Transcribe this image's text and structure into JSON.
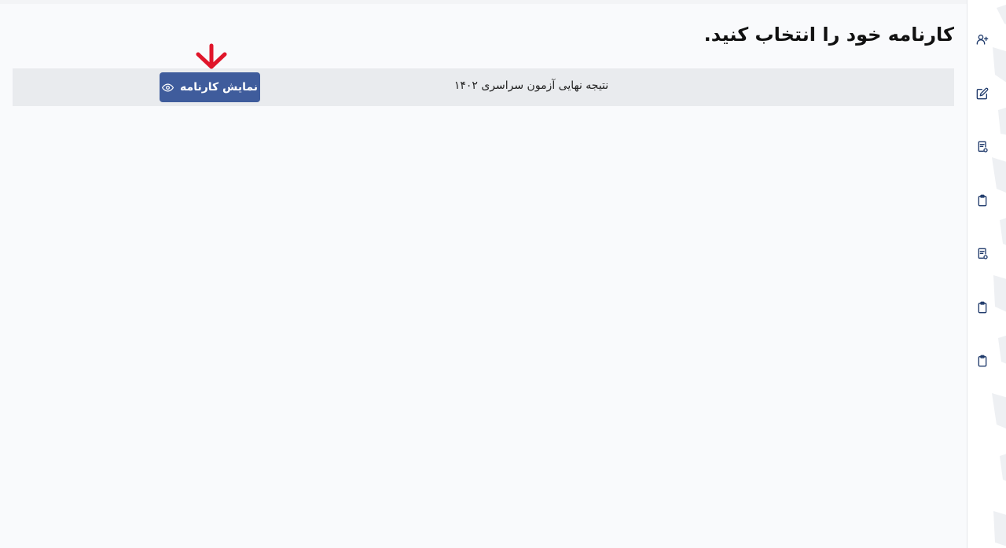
{
  "main": {
    "title": "کارنامه خود را انتخاب کنید.",
    "reports": [
      {
        "name": "نتیجه نهایی آزمون سراسری ۱۴۰۲",
        "button_label": "نمایش کارنامه",
        "button_icon": "eye-icon"
      }
    ]
  },
  "annotation": {
    "icon": "arrow-down-icon",
    "color": "#e0162b"
  },
  "sidebar": {
    "items": [
      {
        "icon": "user-plus-icon"
      },
      {
        "icon": "edit-icon"
      },
      {
        "icon": "document-badge-icon"
      },
      {
        "icon": "clipboard-icon"
      },
      {
        "icon": "document-badge-icon"
      },
      {
        "icon": "clipboard-icon"
      },
      {
        "icon": "clipboard-icon"
      }
    ]
  },
  "colors": {
    "accent": "#3f5c9c",
    "row_background": "#e9ebee",
    "page_background": "#f9fafc",
    "icon": "#1f3a6b"
  }
}
